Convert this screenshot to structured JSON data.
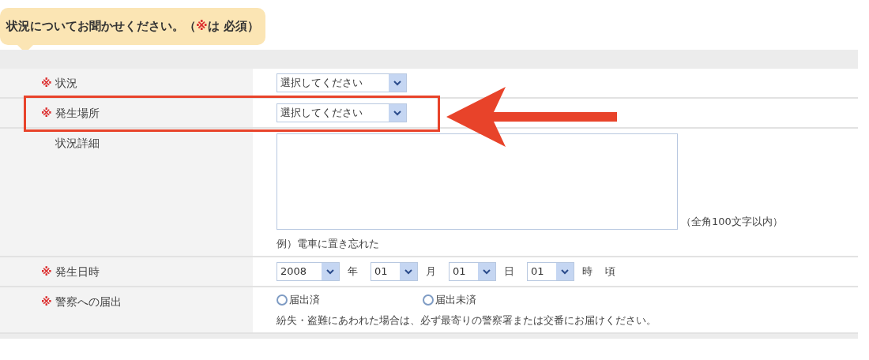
{
  "header": {
    "before": "状況についてお聞かせください。（",
    "mark": "※",
    "after": "は 必須）"
  },
  "rows": [
    {
      "kind": "select",
      "label": "状況",
      "required": true,
      "highlighted": false,
      "value": "選択してください"
    },
    {
      "kind": "select",
      "label": "発生場所",
      "required": true,
      "highlighted": true,
      "value": "選択してください"
    },
    {
      "kind": "textarea",
      "label": "状況詳細",
      "required": false,
      "highlighted": false,
      "limit": "（全角100文字以内）",
      "example": "例）電車に置き忘れた"
    },
    {
      "kind": "datetime",
      "label": "発生日時",
      "required": true,
      "highlighted": false,
      "parts": [
        {
          "value": "2008",
          "unit": "年"
        },
        {
          "value": "01",
          "unit": "月"
        },
        {
          "value": "01",
          "unit": "日"
        },
        {
          "value": "01",
          "unit": "時"
        }
      ],
      "suffix": "頃"
    },
    {
      "kind": "radio",
      "label": "警察への届出",
      "required": true,
      "highlighted": false,
      "options": [
        {
          "label": "届出済",
          "selected": false
        },
        {
          "label": "届出未済",
          "selected": false
        }
      ],
      "note": "紛失・盗難にあわれた場合は、必ず最寄りの警察署または交番にお届けください。"
    }
  ],
  "mark": "※"
}
